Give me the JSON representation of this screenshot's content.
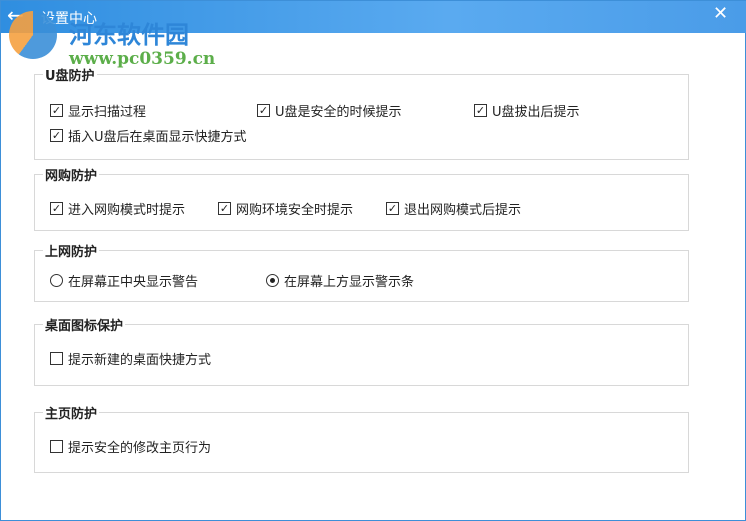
{
  "header": {
    "title": "设置中心",
    "back_icon": "arrow-left-icon",
    "close_icon": "close-icon"
  },
  "watermark": {
    "name": "河东软件园",
    "url": "www.pc0359.cn"
  },
  "groups": [
    {
      "label": "U盘防护",
      "options": [
        {
          "label": "显示扫描过程",
          "checked": true
        },
        {
          "label": "U盘是安全的时候提示",
          "checked": true
        },
        {
          "label": "U盘拔出后提示",
          "checked": true
        },
        {
          "label": "插入U盘后在桌面显示快捷方式",
          "checked": true
        }
      ]
    },
    {
      "label": "网购防护",
      "options": [
        {
          "label": "进入网购模式时提示",
          "checked": true
        },
        {
          "label": "网购环境安全时提示",
          "checked": true
        },
        {
          "label": "退出网购模式后提示",
          "checked": true
        }
      ]
    },
    {
      "label": "上网防护",
      "options": [
        {
          "label": "在屏幕正中央显示警告",
          "selected": false
        },
        {
          "label": "在屏幕上方显示警示条",
          "selected": true
        }
      ]
    },
    {
      "label": "桌面图标保护",
      "options": [
        {
          "label": "提示新建的桌面快捷方式",
          "checked": false
        }
      ]
    },
    {
      "label": "主页防护",
      "options": [
        {
          "label": "提示安全的修改主页行为",
          "checked": false
        }
      ]
    }
  ]
}
